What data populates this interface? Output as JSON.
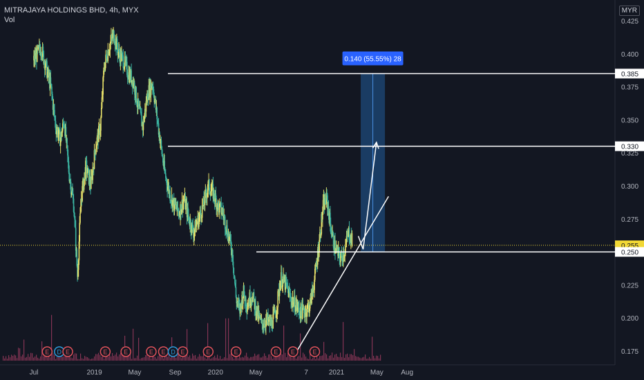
{
  "header": {
    "title": "MITRAJAYA HOLDINGS BHD, 4h, MYX",
    "volume_label": "Vol",
    "currency": "MYR"
  },
  "chart_data": {
    "type": "candlestick",
    "symbol": "MITRAJAYA HOLDINGS BHD",
    "interval": "4h",
    "exchange": "MYX",
    "currency": "MYR",
    "ylim": [
      0.17,
      0.43
    ],
    "y_ticks": [
      "0.175",
      "0.200",
      "0.225",
      "0.250",
      "0.275",
      "0.300",
      "0.325",
      "0.350",
      "0.375",
      "0.400",
      "0.425"
    ],
    "x_ticks": [
      {
        "label": "Jul",
        "t": 0.0
      },
      {
        "label": "2019",
        "t": 0.5
      },
      {
        "label": "May",
        "t": 0.833
      },
      {
        "label": "Sep",
        "t": 1.167
      },
      {
        "label": "2020",
        "t": 1.5
      },
      {
        "label": "May",
        "t": 1.833
      },
      {
        "label": "7",
        "t": 2.25
      },
      {
        "label": "2021",
        "t": 2.5
      },
      {
        "label": "May",
        "t": 2.833
      },
      {
        "label": "Aug",
        "t": 3.083
      }
    ],
    "series": [
      {
        "name": "price",
        "color_up": "#e8e16a",
        "color_down": "#3bb3a0",
        "points": [
          {
            "t": 0.0,
            "v": 0.395
          },
          {
            "t": 0.06,
            "v": 0.405
          },
          {
            "t": 0.1,
            "v": 0.39
          },
          {
            "t": 0.14,
            "v": 0.375
          },
          {
            "t": 0.18,
            "v": 0.345
          },
          {
            "t": 0.22,
            "v": 0.335
          },
          {
            "t": 0.25,
            "v": 0.35
          },
          {
            "t": 0.29,
            "v": 0.31
          },
          {
            "t": 0.33,
            "v": 0.285
          },
          {
            "t": 0.36,
            "v": 0.232
          },
          {
            "t": 0.39,
            "v": 0.29
          },
          {
            "t": 0.43,
            "v": 0.315
          },
          {
            "t": 0.47,
            "v": 0.3
          },
          {
            "t": 0.51,
            "v": 0.33
          },
          {
            "t": 0.55,
            "v": 0.345
          },
          {
            "t": 0.58,
            "v": 0.39
          },
          {
            "t": 0.62,
            "v": 0.405
          },
          {
            "t": 0.66,
            "v": 0.415
          },
          {
            "t": 0.7,
            "v": 0.4
          },
          {
            "t": 0.74,
            "v": 0.395
          },
          {
            "t": 0.78,
            "v": 0.385
          },
          {
            "t": 0.82,
            "v": 0.38
          },
          {
            "t": 0.86,
            "v": 0.36
          },
          {
            "t": 0.9,
            "v": 0.345
          },
          {
            "t": 0.94,
            "v": 0.37
          },
          {
            "t": 0.98,
            "v": 0.378
          },
          {
            "t": 1.02,
            "v": 0.35
          },
          {
            "t": 1.05,
            "v": 0.33
          },
          {
            "t": 1.08,
            "v": 0.31
          },
          {
            "t": 1.12,
            "v": 0.295
          },
          {
            "t": 1.16,
            "v": 0.285
          },
          {
            "t": 1.2,
            "v": 0.28
          },
          {
            "t": 1.24,
            "v": 0.29
          },
          {
            "t": 1.28,
            "v": 0.275
          },
          {
            "t": 1.32,
            "v": 0.265
          },
          {
            "t": 1.36,
            "v": 0.275
          },
          {
            "t": 1.4,
            "v": 0.285
          },
          {
            "t": 1.44,
            "v": 0.3
          },
          {
            "t": 1.48,
            "v": 0.295
          },
          {
            "t": 1.52,
            "v": 0.285
          },
          {
            "t": 1.56,
            "v": 0.28
          },
          {
            "t": 1.6,
            "v": 0.265
          },
          {
            "t": 1.64,
            "v": 0.25
          },
          {
            "t": 1.67,
            "v": 0.215
          },
          {
            "t": 1.7,
            "v": 0.205
          },
          {
            "t": 1.73,
            "v": 0.22
          },
          {
            "t": 1.76,
            "v": 0.21
          },
          {
            "t": 1.8,
            "v": 0.218
          },
          {
            "t": 1.84,
            "v": 0.205
          },
          {
            "t": 1.88,
            "v": 0.195
          },
          {
            "t": 1.92,
            "v": 0.198
          },
          {
            "t": 1.96,
            "v": 0.195
          },
          {
            "t": 2.0,
            "v": 0.205
          },
          {
            "t": 2.04,
            "v": 0.23
          },
          {
            "t": 2.08,
            "v": 0.225
          },
          {
            "t": 2.12,
            "v": 0.215
          },
          {
            "t": 2.16,
            "v": 0.21
          },
          {
            "t": 2.2,
            "v": 0.205
          },
          {
            "t": 2.24,
            "v": 0.205
          },
          {
            "t": 2.28,
            "v": 0.21
          },
          {
            "t": 2.32,
            "v": 0.23
          },
          {
            "t": 2.36,
            "v": 0.26
          },
          {
            "t": 2.39,
            "v": 0.285
          },
          {
            "t": 2.42,
            "v": 0.29
          },
          {
            "t": 2.45,
            "v": 0.27
          },
          {
            "t": 2.48,
            "v": 0.255
          },
          {
            "t": 2.51,
            "v": 0.248
          },
          {
            "t": 2.54,
            "v": 0.245
          },
          {
            "t": 2.57,
            "v": 0.252
          },
          {
            "t": 2.6,
            "v": 0.265
          },
          {
            "t": 2.63,
            "v": 0.258
          }
        ]
      }
    ],
    "horizontal_levels": [
      0.385,
      0.33,
      0.25
    ],
    "price_labels": [
      {
        "value": 0.385,
        "text": "0.385",
        "style": "white"
      },
      {
        "value": 0.33,
        "text": "0.330",
        "style": "white"
      },
      {
        "value": 0.255,
        "text": "0.255",
        "style": "last"
      },
      {
        "value": 0.25,
        "text": "0.250",
        "style": "white"
      }
    ],
    "last_price": 0.255,
    "measure_box": {
      "from": 0.25,
      "to": 0.385,
      "t_start": 2.7,
      "t_end": 2.9,
      "label": "0.140 (55.55%) 28"
    },
    "projection_arrow": [
      {
        "t": 2.68,
        "v": 0.262
      },
      {
        "t": 2.72,
        "v": 0.252
      },
      {
        "t": 2.83,
        "v": 0.333
      }
    ],
    "trendline": [
      {
        "t": 2.16,
        "v": 0.173
      },
      {
        "t": 2.93,
        "v": 0.292
      }
    ],
    "event_markers": [
      {
        "t": 0.11,
        "type": "E"
      },
      {
        "t": 0.21,
        "type": "D"
      },
      {
        "t": 0.28,
        "type": "E"
      },
      {
        "t": 0.59,
        "type": "E"
      },
      {
        "t": 0.76,
        "type": "E"
      },
      {
        "t": 0.97,
        "type": "E"
      },
      {
        "t": 1.07,
        "type": "E"
      },
      {
        "t": 1.15,
        "type": "D"
      },
      {
        "t": 1.23,
        "type": "E"
      },
      {
        "t": 1.44,
        "type": "E"
      },
      {
        "t": 1.67,
        "type": "E"
      },
      {
        "t": 2.0,
        "type": "E"
      },
      {
        "t": 2.14,
        "type": "E"
      },
      {
        "t": 2.32,
        "type": "E"
      }
    ],
    "colors": {
      "background": "#131722",
      "up": "#e8e16a",
      "down": "#3bb3a0",
      "measure_fill": "#1e4a7a",
      "measure_label": "#2962ff",
      "last_price": "#f2d835",
      "volume": "#b5436a",
      "grid": "#1e222d"
    }
  }
}
